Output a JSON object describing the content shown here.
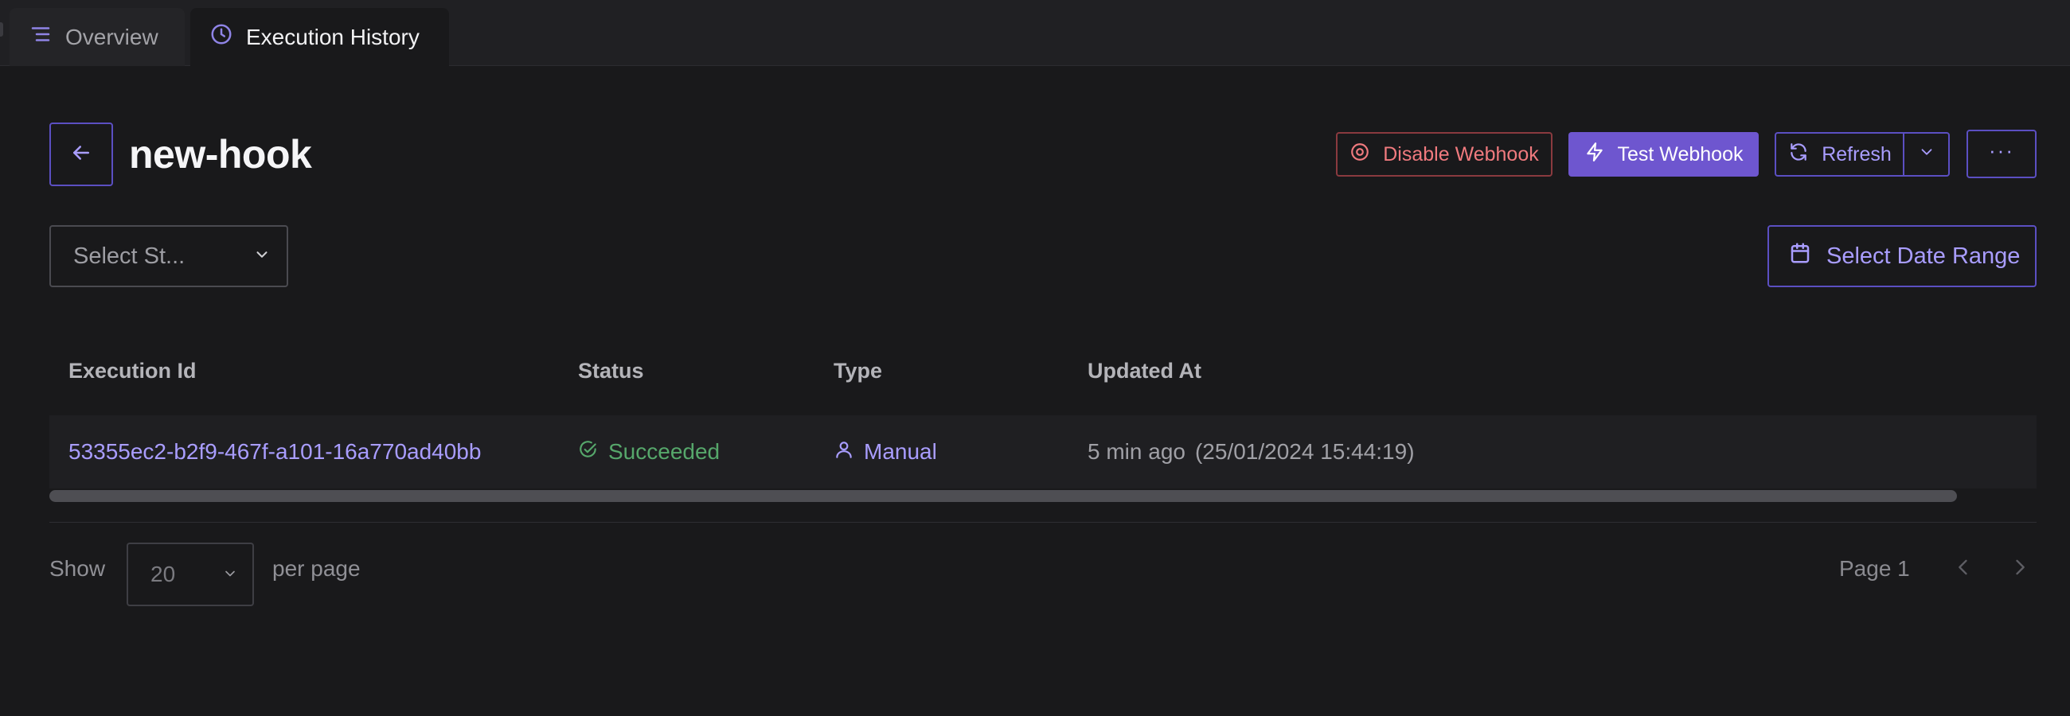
{
  "tabs": [
    {
      "label": "Overview",
      "icon": "list-icon"
    },
    {
      "label": "Execution History",
      "icon": "clock-icon"
    }
  ],
  "header": {
    "title": "new-hook",
    "disable_label": "Disable Webhook",
    "test_label": "Test Webhook",
    "refresh_label": "Refresh",
    "more_label": "···"
  },
  "filters": {
    "status_placeholder": "Select St...",
    "date_range_label": "Select Date Range"
  },
  "table": {
    "columns": [
      "Execution Id",
      "Status",
      "Type",
      "Updated At"
    ],
    "rows": [
      {
        "execution_id": "53355ec2-b2f9-467f-a101-16a770ad40bb",
        "status": "Succeeded",
        "type": "Manual",
        "updated_relative": "5 min ago",
        "updated_absolute": "(25/01/2024 15:44:19)"
      }
    ]
  },
  "pagination": {
    "show_label": "Show",
    "per_page_value": "20",
    "per_page_label": "per page",
    "page_label": "Page 1"
  },
  "colors": {
    "accent": "#6e56cf",
    "accent_text": "#a99dff",
    "danger": "#f07a7e",
    "success": "#56a76b",
    "background": "#19191b"
  }
}
